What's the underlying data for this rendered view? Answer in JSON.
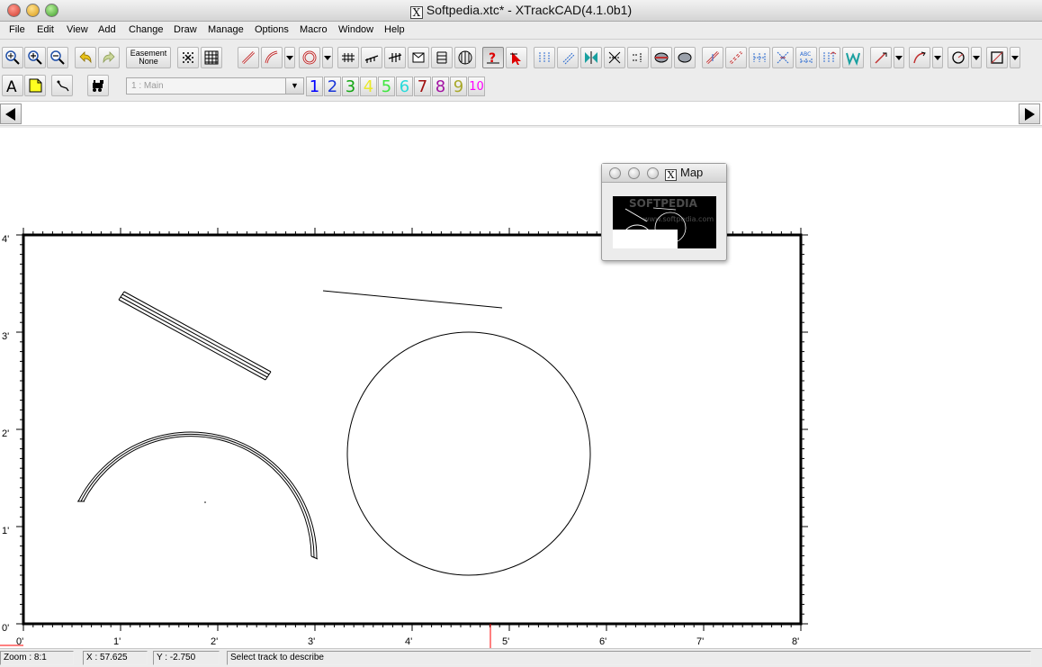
{
  "window": {
    "title": "Softpedia.xtc* - XTrackCAD(4.1.0b1)",
    "x11_badge": "X"
  },
  "menu": [
    "File",
    "Edit",
    "View",
    "Add",
    "Change",
    "Draw",
    "Manage",
    "Options",
    "Macro",
    "Window",
    "Help"
  ],
  "toolbar": {
    "easement_line1": "Easement",
    "easement_line2": "None",
    "layer_select_value": "1 : Main",
    "layers": [
      {
        "label": "1",
        "color": "#0000ff"
      },
      {
        "label": "2",
        "color": "#1a36d8"
      },
      {
        "label": "3",
        "color": "#13a513"
      },
      {
        "label": "4",
        "color": "#e9e92a"
      },
      {
        "label": "5",
        "color": "#3fe63f"
      },
      {
        "label": "6",
        "color": "#27dada"
      },
      {
        "label": "7",
        "color": "#a01010"
      },
      {
        "label": "8",
        "color": "#a313a3"
      },
      {
        "label": "9",
        "color": "#a8a82a"
      },
      {
        "label": "10",
        "color": "#ff00ff"
      }
    ]
  },
  "ruler": {
    "y_labels": [
      "4'",
      "3'",
      "2'",
      "1'",
      "0'"
    ],
    "x_labels": [
      "0'",
      "1'",
      "2'",
      "3'",
      "4'",
      "5'",
      "6'",
      "7'",
      "8'"
    ]
  },
  "map_window": {
    "title": "Map",
    "x11_badge": "X",
    "watermark": "SOFTPEDIA",
    "watermark_url": "www.softpedia.com"
  },
  "status": {
    "zoom": "Zoom : 8:1",
    "x": "X : 57.625",
    "y": "Y : -2.750",
    "message": "Select track to describe"
  },
  "colors": {
    "accent_cursor_mark": "#ff0000",
    "canvas_bg": "#ffffff",
    "map_bg": "#000000"
  }
}
